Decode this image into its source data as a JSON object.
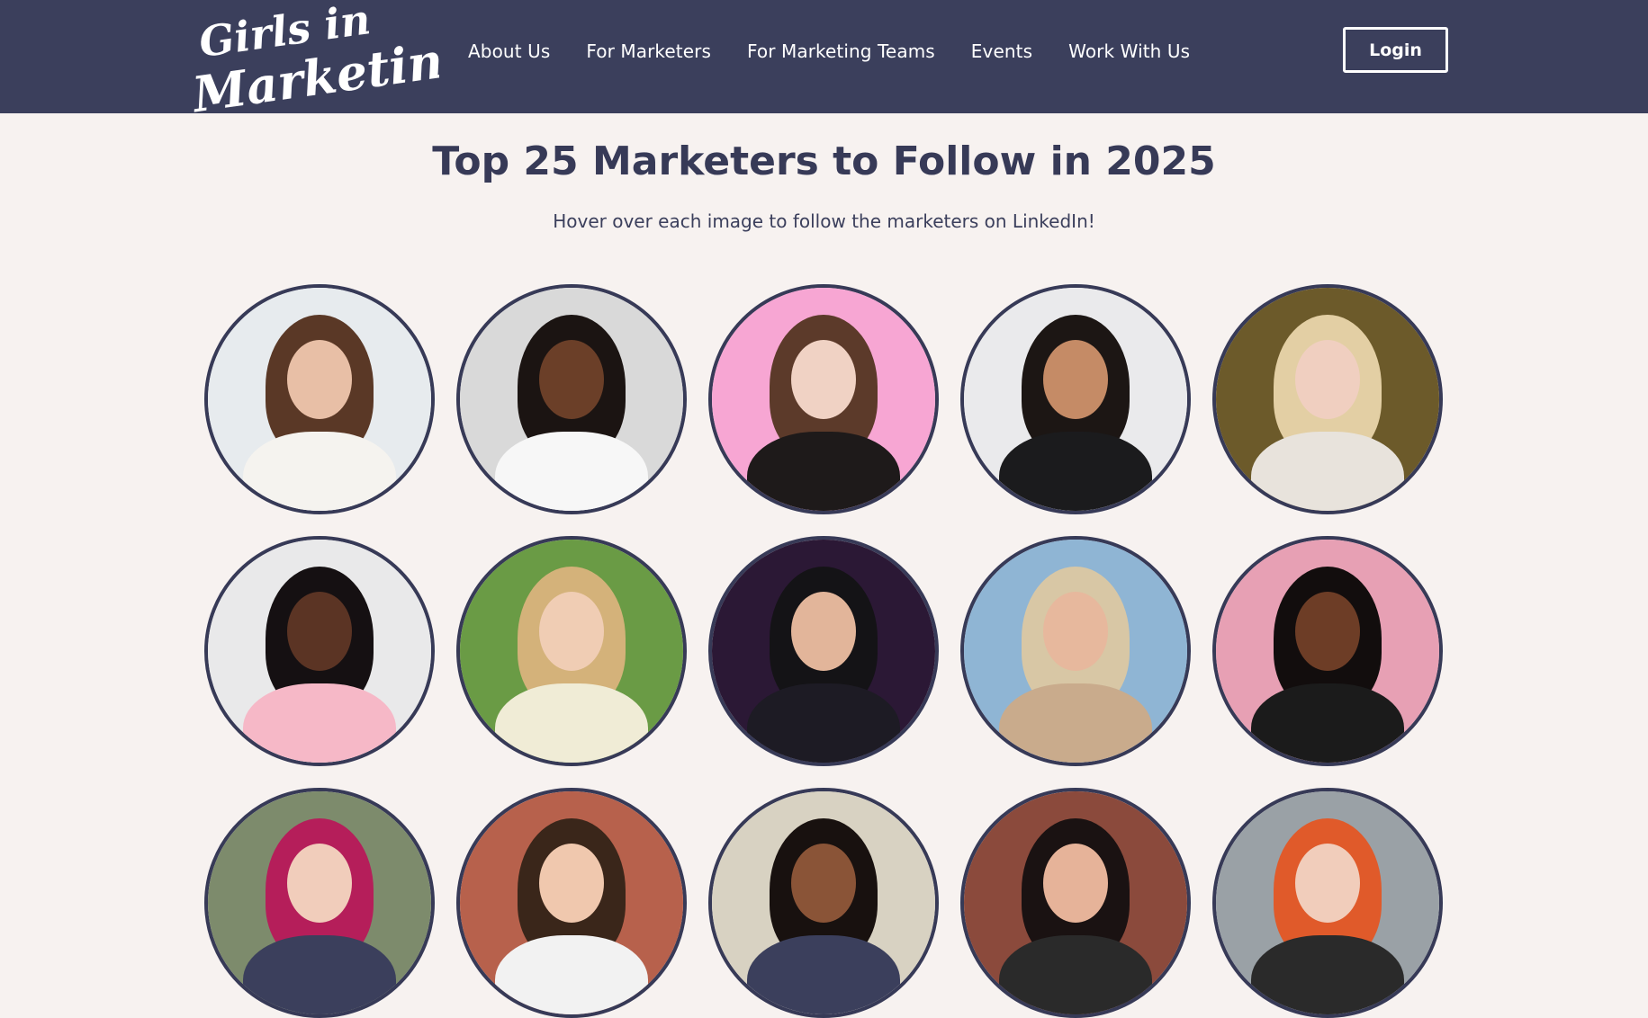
{
  "header": {
    "logo_text": "Girls in Marketing",
    "nav": [
      "About Us",
      "For Marketers",
      "For Marketing Teams",
      "Events",
      "Work With Us"
    ],
    "login_label": "Login",
    "bg_color": "#3b3f5c"
  },
  "main": {
    "title": "Top 25 Marketers to Follow in 2025",
    "subtitle": "Hover over each image to follow the marketers on LinkedIn!"
  },
  "marketers": [
    {
      "bg": "#e7ebee",
      "hair": "#5a3826",
      "skin": "#e8bfa6",
      "top": "#f5f3ef"
    },
    {
      "bg": "#d9d9d9",
      "hair": "#1b1412",
      "skin": "#6b3f28",
      "top": "#f7f7f7"
    },
    {
      "bg": "#f7a6d3",
      "hair": "#5c3a2a",
      "skin": "#f0d2c4",
      "top": "#1e1a1a"
    },
    {
      "bg": "#eaeaec",
      "hair": "#1c1614",
      "skin": "#c58b66",
      "top": "#1b1b1d"
    },
    {
      "bg": "#6c5a2a",
      "hair": "#e3cfa4",
      "skin": "#f0cfc0",
      "top": "#e8e3dc"
    },
    {
      "bg": "#e9e9ea",
      "hair": "#151012",
      "skin": "#5b3424",
      "top": "#f6b8c7"
    },
    {
      "bg": "#6a9b45",
      "hair": "#d4b27a",
      "skin": "#f0cdb4",
      "top": "#f0ecd6"
    },
    {
      "bg": "#2b1835",
      "hair": "#141316",
      "skin": "#e2b59a",
      "top": "#1d1b24"
    },
    {
      "bg": "#8fb5d4",
      "hair": "#d8c7a5",
      "skin": "#e7b89d",
      "top": "#c9ab8c"
    },
    {
      "bg": "#e7a0b4",
      "hair": "#120d0d",
      "skin": "#6d3d26",
      "top": "#1b1b1b"
    },
    {
      "bg": "#7d8b6c",
      "hair": "#b51e5a",
      "skin": "#f1cdbb",
      "top": "#3b3f5c"
    },
    {
      "bg": "#b7614c",
      "hair": "#3a261a",
      "skin": "#f0c8ae",
      "top": "#f2f2f2"
    },
    {
      "bg": "#d8d2c2",
      "hair": "#18110f",
      "skin": "#8a5437",
      "top": "#3b3f5c"
    },
    {
      "bg": "#8b4a3c",
      "hair": "#1a1212",
      "skin": "#e6b399",
      "top": "#2a2a2a"
    },
    {
      "bg": "#9aa1a6",
      "hair": "#e05a2a",
      "skin": "#f1cdbb",
      "top": "#2a2a2a"
    }
  ]
}
